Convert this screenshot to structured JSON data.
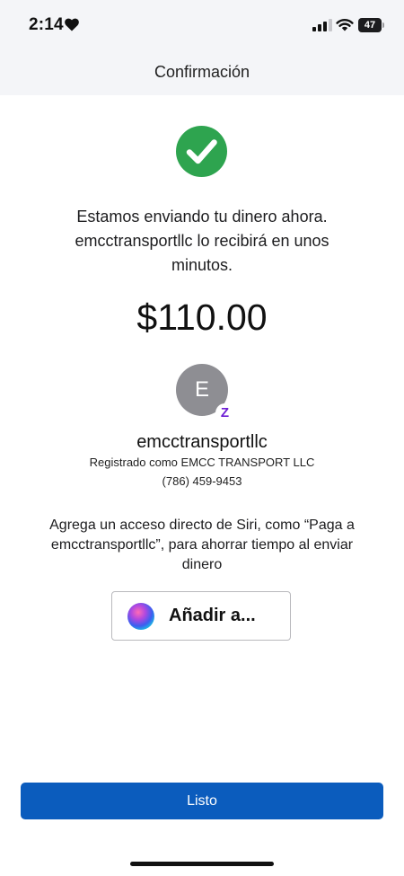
{
  "status_bar": {
    "time": "2:14",
    "battery": "47",
    "icons": [
      "heart-icon",
      "cellular-signal-icon",
      "wifi-icon",
      "battery-icon"
    ]
  },
  "header": {
    "title": "Confirmación"
  },
  "confirmation": {
    "status_icon": "check-circle-icon",
    "line1": "Estamos enviando tu dinero ahora.",
    "line2": "emcctransportllc lo recibirá en unos",
    "line3": "minutos.",
    "amount": "$110.00"
  },
  "recipient": {
    "initial": "E",
    "badge_icon": "zelle-icon",
    "badge": "Z",
    "name": "emcctransportllc",
    "registered": "Registrado como EMCC TRANSPORT LLC",
    "phone": "(786) 459-9453"
  },
  "siri": {
    "line1": "Agrega un acceso directo de Siri, como “Paga a",
    "line2": "emcctransportllc”, para ahorrar tiempo al enviar",
    "line3": "dinero",
    "icon": "siri-icon",
    "button_label": "Añadir a..."
  },
  "actions": {
    "done_label": "Listo"
  },
  "colors": {
    "header_bg": "#f4f5f8",
    "success": "#2ea44f",
    "primary_button": "#0b5cbd",
    "avatar": "#8e8e93",
    "zelle": "#6d1ed4"
  }
}
